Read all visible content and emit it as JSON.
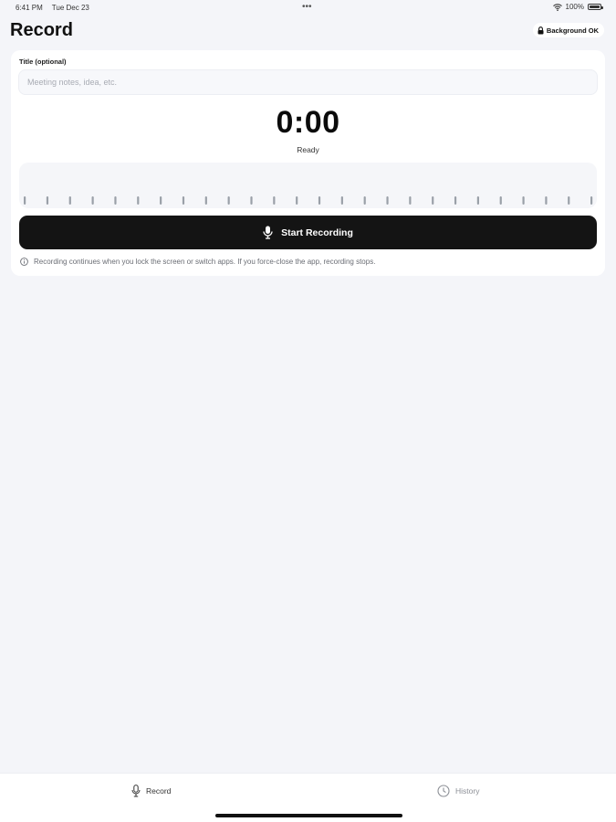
{
  "status_bar": {
    "time": "6:41 PM",
    "date": "Tue Dec 23",
    "dots": "•••",
    "battery": "100%",
    "wifi_icon": "wifi-icon",
    "battery_icon": "battery-icon"
  },
  "header": {
    "title": "Record",
    "badge": {
      "label": "Background OK",
      "icon": "lock-icon"
    }
  },
  "recorder": {
    "title_field": {
      "label": "Title (optional)",
      "value": "",
      "placeholder": "Meeting notes, idea, etc."
    },
    "timer": "0:00",
    "status": "Ready",
    "waveform_bars": 26,
    "button": {
      "label": "Start Recording",
      "icon": "microphone-icon"
    },
    "note": {
      "icon": "info-icon",
      "text": "Recording continues when you lock the screen or switch apps. If you force-close the app, recording stops."
    }
  },
  "tabs": [
    {
      "label": "Record",
      "icon": "microphone-icon",
      "active": true
    },
    {
      "label": "History",
      "icon": "clock-icon",
      "active": false
    }
  ],
  "colors": {
    "background": "#f4f5f9",
    "card": "#ffffff",
    "button": "#141414",
    "waveform_bar": "#9aa0a8",
    "active_tab": "#333333",
    "inactive_tab": "#8c8f96"
  }
}
